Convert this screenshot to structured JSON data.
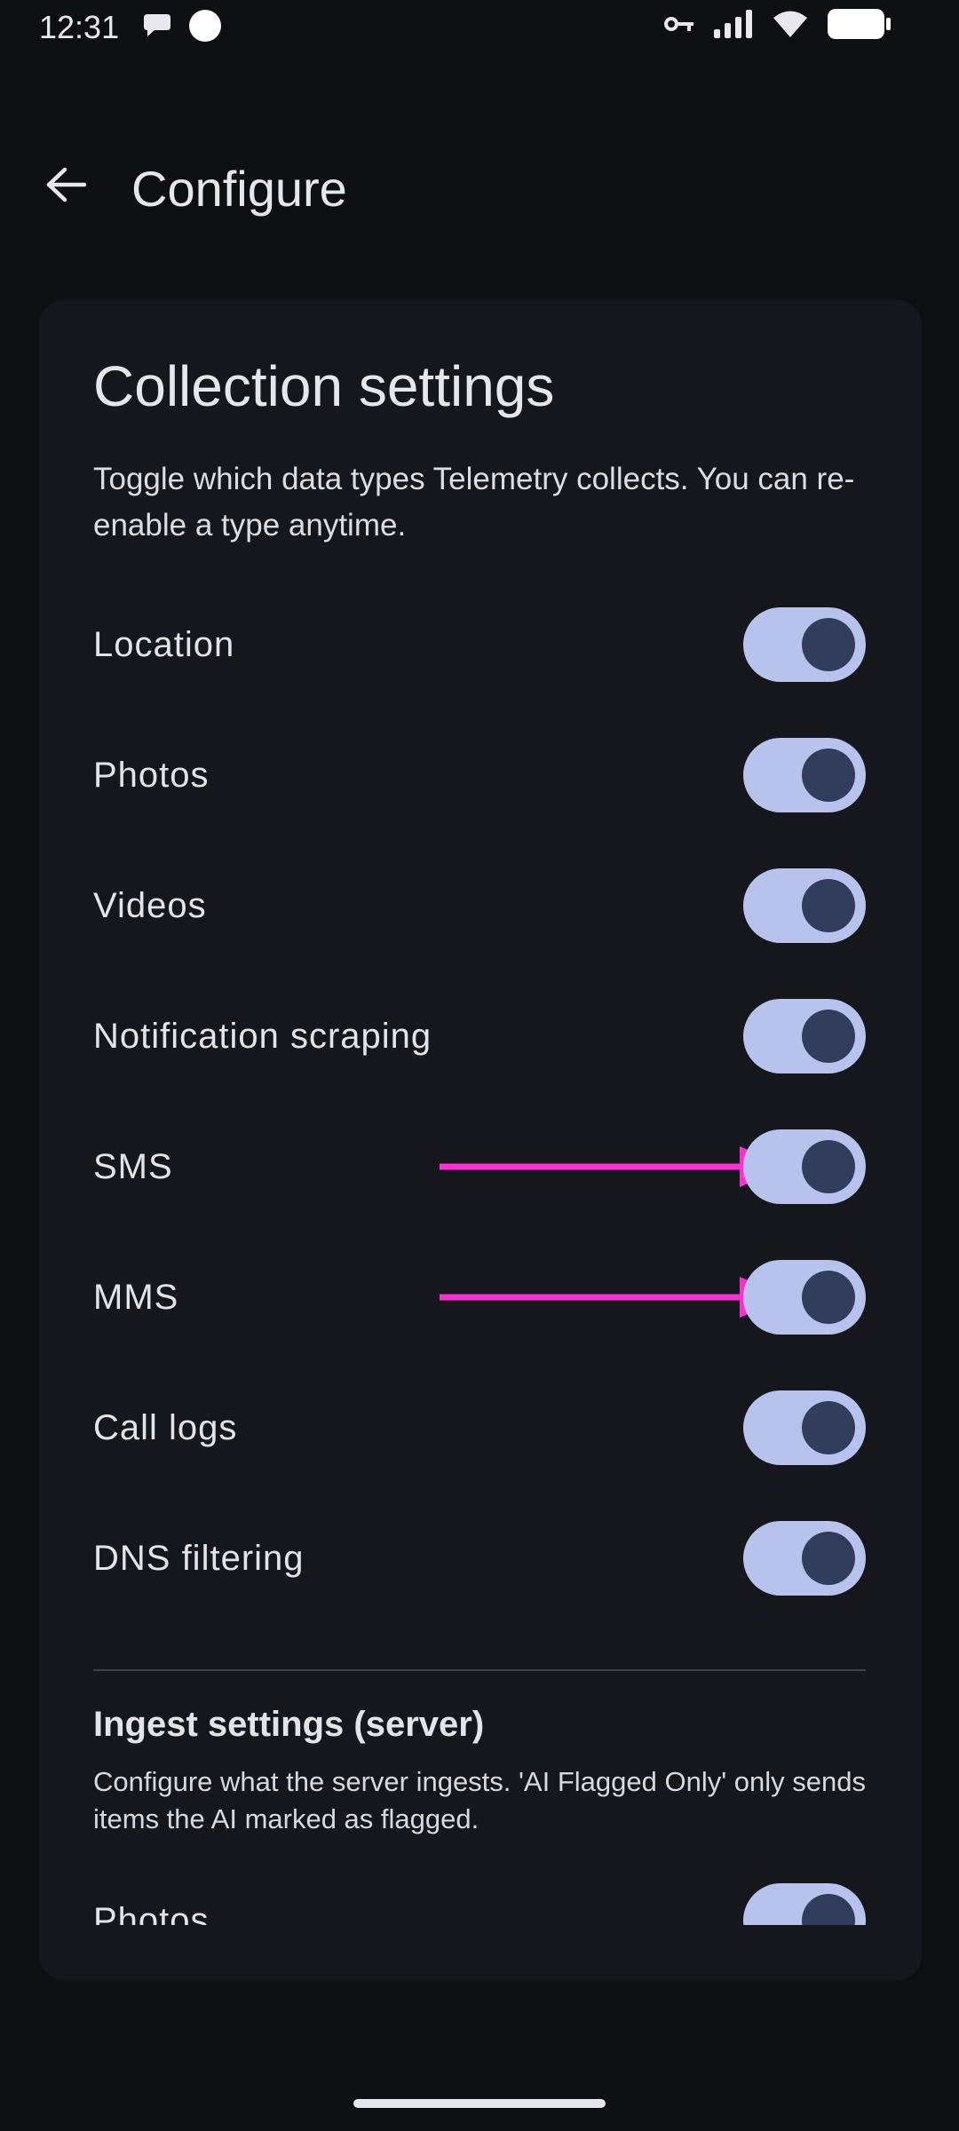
{
  "status_bar": {
    "time": "12:31",
    "left_icons": [
      "chat-bubble-icon",
      "circle-icon"
    ],
    "right_icons": [
      "vpn-key-icon",
      "signal-icon",
      "wifi-icon",
      "battery-icon"
    ]
  },
  "app_bar": {
    "back_icon": "arrow-back-icon",
    "title": "Configure"
  },
  "collection": {
    "title": "Collection settings",
    "description": "Toggle which data types Telemetry collects. You can re-enable a type anytime.",
    "items": [
      {
        "label": "Location",
        "enabled": true
      },
      {
        "label": "Photos",
        "enabled": true
      },
      {
        "label": "Videos",
        "enabled": true
      },
      {
        "label": "Notification scraping",
        "enabled": true
      },
      {
        "label": "SMS",
        "enabled": true
      },
      {
        "label": "MMS",
        "enabled": true
      },
      {
        "label": "Call logs",
        "enabled": true
      },
      {
        "label": "DNS filtering",
        "enabled": true
      }
    ]
  },
  "ingest": {
    "title": "Ingest settings (server)",
    "description": "Configure what the server ingests. 'AI Flagged Only' only sends items the AI marked as flagged.",
    "items": [
      {
        "label": "Photos",
        "enabled": true
      }
    ]
  },
  "colors": {
    "background": "#0e0f13",
    "card": "#16171d",
    "toggle_track": "#b8c3ed",
    "toggle_knob": "#323d5d",
    "annotation_arrow": "#ff2fd6"
  }
}
